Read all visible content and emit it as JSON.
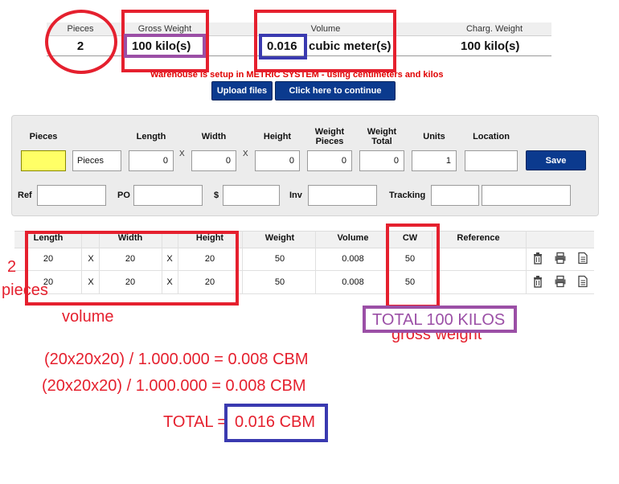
{
  "summary": {
    "pieces_label": "Pieces",
    "pieces_value": "2",
    "gross_label": "Gross Weight",
    "gross_value": "100  kilo(s)",
    "volume_label": "Volume",
    "volume_number": "0.016",
    "volume_unit": "cubic meter(s)",
    "charg_label": "Charg. Weight",
    "charg_value": "100  kilo(s)"
  },
  "notice": "Warehouse is setup in  METRIC SYSTEM - using centimeters and kilos",
  "buttons": {
    "upload": "Upload files",
    "continue": "Click here to continue",
    "save": "Save"
  },
  "form": {
    "labels": {
      "pieces": "Pieces",
      "length": "Length",
      "width": "Width",
      "height": "Height",
      "weight_pieces": "Weight Pieces",
      "weight_total": "Weight Total",
      "units": "Units",
      "location": "Location",
      "ref": "Ref",
      "po": "PO",
      "dollar": "$",
      "inv": "Inv",
      "tracking": "Tracking"
    },
    "values": {
      "pieces": "",
      "pieces_type": "Pieces",
      "length": "0",
      "width": "0",
      "height": "0",
      "weight_pieces": "0",
      "weight_total": "0",
      "units": "1",
      "location": "",
      "ref": "",
      "po": "",
      "dollar": "",
      "inv": "",
      "tracking": "",
      "tracking2": ""
    },
    "x_symbol": "X"
  },
  "table": {
    "headers": {
      "length": "Length",
      "width": "Width",
      "height": "Height",
      "weight": "Weight",
      "volume": "Volume",
      "cw": "CW",
      "reference": "Reference"
    },
    "rows": [
      {
        "length": "20",
        "x1": "X",
        "width": "20",
        "x2": "X",
        "height": "20",
        "weight": "50",
        "volume": "0.008",
        "cw": "50",
        "reference": ""
      },
      {
        "length": "20",
        "x1": "X",
        "width": "20",
        "x2": "X",
        "height": "20",
        "weight": "50",
        "volume": "0.008",
        "cw": "50",
        "reference": ""
      }
    ],
    "row_icons": [
      "trash-icon",
      "printer-icon",
      "document-icon"
    ]
  },
  "annotations": {
    "two_pieces_num": "2",
    "two_pieces_word": "pieces",
    "volume": "volume",
    "total_kilos": "TOTAL 100 KILOS",
    "gross_weight": "gross weight",
    "formula1": "(20x20x20) / 1.000.000 = 0.008 CBM",
    "formula2": "(20x20x20) / 1.000.000 = 0.008 CBM",
    "total_cbm_prefix": "TOTAL = ",
    "total_cbm_value": "0.016 CBM"
  },
  "colors": {
    "annotation_red": "#e5202e",
    "annotation_purple": "#9b4fa6",
    "annotation_blue": "#3a3ab0",
    "button_blue": "#0b3a8e",
    "pieces_input_yellow": "#ffff66"
  }
}
